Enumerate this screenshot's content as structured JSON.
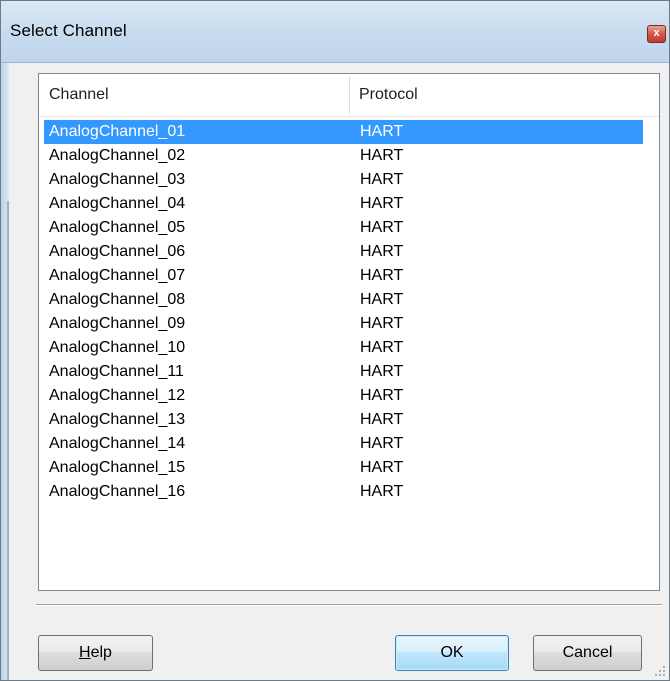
{
  "window": {
    "title": "Select Channel",
    "close_glyph": "x"
  },
  "listview": {
    "columns": [
      "Channel",
      "Protocol"
    ],
    "selected_index": 0,
    "rows": [
      {
        "channel": "AnalogChannel_01",
        "protocol": "HART"
      },
      {
        "channel": "AnalogChannel_02",
        "protocol": "HART"
      },
      {
        "channel": "AnalogChannel_03",
        "protocol": "HART"
      },
      {
        "channel": "AnalogChannel_04",
        "protocol": "HART"
      },
      {
        "channel": "AnalogChannel_05",
        "protocol": "HART"
      },
      {
        "channel": "AnalogChannel_06",
        "protocol": "HART"
      },
      {
        "channel": "AnalogChannel_07",
        "protocol": "HART"
      },
      {
        "channel": "AnalogChannel_08",
        "protocol": "HART"
      },
      {
        "channel": "AnalogChannel_09",
        "protocol": "HART"
      },
      {
        "channel": "AnalogChannel_10",
        "protocol": "HART"
      },
      {
        "channel": "AnalogChannel_11",
        "protocol": "HART"
      },
      {
        "channel": "AnalogChannel_12",
        "protocol": "HART"
      },
      {
        "channel": "AnalogChannel_13",
        "protocol": "HART"
      },
      {
        "channel": "AnalogChannel_14",
        "protocol": "HART"
      },
      {
        "channel": "AnalogChannel_15",
        "protocol": "HART"
      },
      {
        "channel": "AnalogChannel_16",
        "protocol": "HART"
      }
    ]
  },
  "buttons": {
    "help_mnemonic": "H",
    "help_rest": "elp",
    "ok": "OK",
    "cancel": "Cancel"
  },
  "colors": {
    "selection": "#3399ff",
    "titlebar": "#c9dcef",
    "close_button": "#c23a2d",
    "default_button_border": "#3c7fb1"
  }
}
